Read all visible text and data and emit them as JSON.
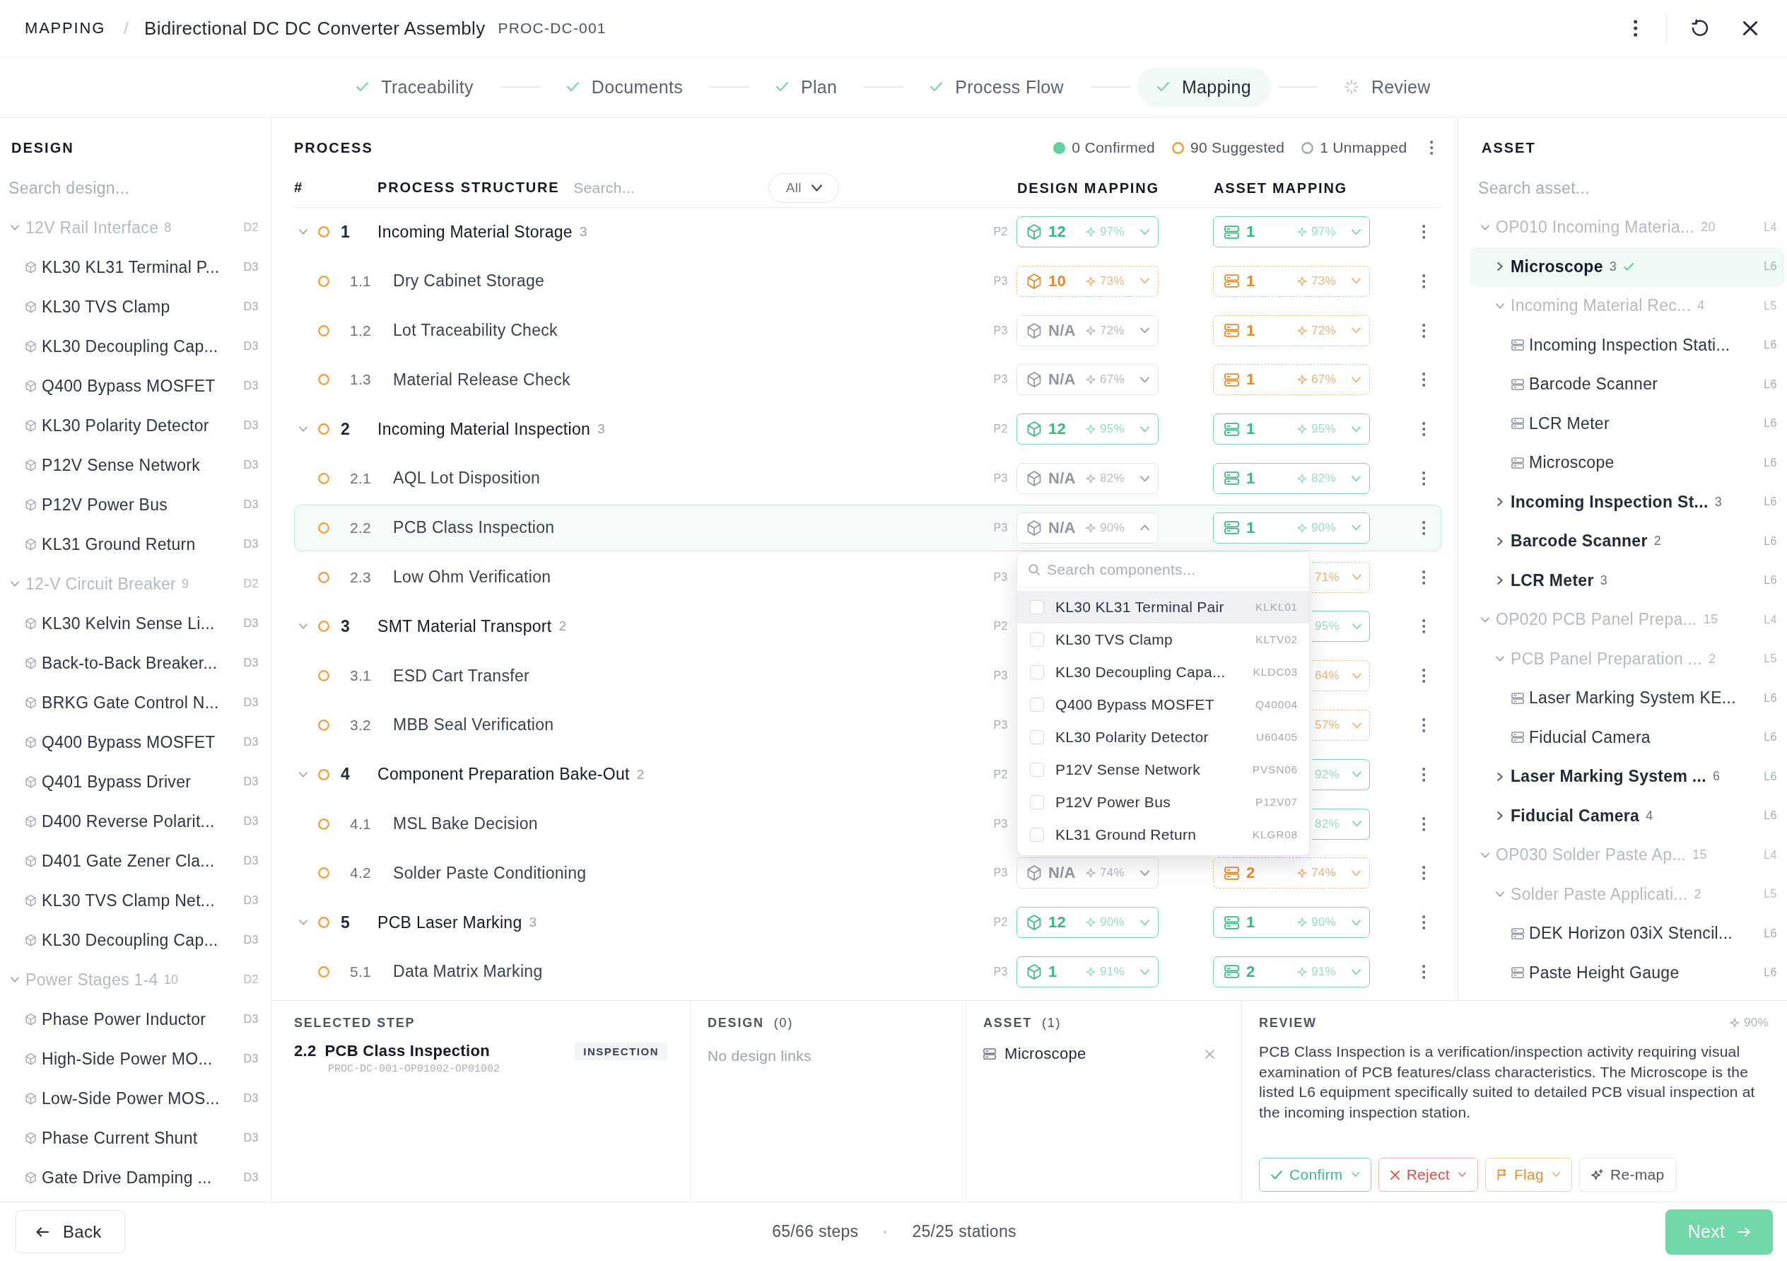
{
  "header": {
    "section": "MAPPING",
    "separator": "/",
    "title": "Bidirectional DC DC Converter Assembly",
    "code": "PROC-DC-001"
  },
  "steps": [
    {
      "label": "Traceability",
      "kind": "done",
      "selected": false
    },
    {
      "label": "Documents",
      "kind": "done",
      "selected": false
    },
    {
      "label": "Plan",
      "kind": "done",
      "selected": false
    },
    {
      "label": "Process Flow",
      "kind": "done",
      "selected": false
    },
    {
      "label": "Mapping",
      "kind": "done",
      "selected": true
    },
    {
      "label": "Review",
      "kind": "pending",
      "selected": false
    }
  ],
  "design_panel": {
    "title": "DESIGN",
    "search": {
      "placeholder": "Search design..."
    },
    "tree": [
      {
        "label": "12V Rail Interface",
        "count": "8",
        "tag": "D2",
        "expanded": true,
        "disabled": true,
        "children": [
          {
            "label": "KL30 KL31 Terminal P...",
            "tag": "D3"
          },
          {
            "label": "KL30 TVS Clamp",
            "tag": "D3"
          },
          {
            "label": "KL30 Decoupling Cap...",
            "tag": "D3"
          },
          {
            "label": "Q400 Bypass MOSFET",
            "tag": "D3"
          },
          {
            "label": "KL30 Polarity Detector",
            "tag": "D3"
          },
          {
            "label": "P12V Sense Network",
            "tag": "D3"
          },
          {
            "label": "P12V Power Bus",
            "tag": "D3"
          },
          {
            "label": "KL31 Ground Return",
            "tag": "D3"
          }
        ]
      },
      {
        "label": "12-V Circuit Breaker",
        "count": "9",
        "tag": "D2",
        "expanded": true,
        "disabled": true,
        "children": [
          {
            "label": "KL30 Kelvin Sense Li...",
            "tag": "D3"
          },
          {
            "label": "Back-to-Back Breaker...",
            "tag": "D3"
          },
          {
            "label": "BRKG Gate Control N...",
            "tag": "D3"
          },
          {
            "label": "Q400 Bypass MOSFET",
            "tag": "D3"
          },
          {
            "label": "Q401 Bypass Driver",
            "tag": "D3"
          },
          {
            "label": "D400 Reverse Polarit...",
            "tag": "D3"
          },
          {
            "label": "D401 Gate Zener Cla...",
            "tag": "D3"
          },
          {
            "label": "KL30 TVS Clamp Net...",
            "tag": "D3"
          },
          {
            "label": "KL30 Decoupling Cap...",
            "tag": "D3"
          }
        ]
      },
      {
        "label": "Power Stages 1-4",
        "count": "10",
        "tag": "D2",
        "expanded": true,
        "disabled": true,
        "children": [
          {
            "label": "Phase Power Inductor",
            "tag": "D3"
          },
          {
            "label": "High-Side Power MO...",
            "tag": "D3"
          },
          {
            "label": "Low-Side Power MOS...",
            "tag": "D3"
          },
          {
            "label": "Phase Current Shunt",
            "tag": "D3"
          },
          {
            "label": "Gate Drive Damping ...",
            "tag": "D3"
          }
        ]
      }
    ]
  },
  "process_panel": {
    "title": "PROCESS",
    "legend": [
      {
        "label": "0 Confirmed",
        "kind": "confirmed"
      },
      {
        "label": "90 Suggested",
        "kind": "suggested"
      },
      {
        "label": "1 Unmapped",
        "kind": "unmapped"
      }
    ],
    "columns": {
      "number": "#",
      "structure": "PROCESS STRUCTURE",
      "design": "DESIGN MAPPING",
      "asset": "ASSET MAPPING"
    },
    "search": {
      "placeholder": "Search..."
    },
    "filter": {
      "value": "All"
    },
    "rows": [
      {
        "number": "1",
        "name": "Incoming Material Storage",
        "count": "3",
        "tag": "P2",
        "kind": "suggested",
        "expanded": true,
        "selected": false,
        "design": {
          "kind": "high",
          "value": "12",
          "confidence": "97%",
          "open": false
        },
        "asset": {
          "kind": "high",
          "value": "1",
          "confidence": "97%"
        },
        "children": [
          {
            "number": "1.1",
            "name": "Dry Cabinet Storage",
            "tag": "P3",
            "kind": "suggested",
            "selected": false,
            "design": {
              "kind": "medium",
              "value": "10",
              "confidence": "73%",
              "open": false
            },
            "asset": {
              "kind": "medium",
              "value": "1",
              "confidence": "73%"
            }
          },
          {
            "number": "1.2",
            "name": "Lot Traceability Check",
            "tag": "P3",
            "kind": "suggested",
            "selected": false,
            "design": {
              "kind": "empty",
              "value": "N/A",
              "confidence": "72%",
              "open": false
            },
            "asset": {
              "kind": "medium",
              "value": "1",
              "confidence": "72%"
            }
          },
          {
            "number": "1.3",
            "name": "Material Release Check",
            "tag": "P3",
            "kind": "suggested",
            "selected": false,
            "design": {
              "kind": "empty",
              "value": "N/A",
              "confidence": "67%",
              "open": false
            },
            "asset": {
              "kind": "medium",
              "value": "1",
              "confidence": "67%"
            }
          }
        ]
      },
      {
        "number": "2",
        "name": "Incoming Material Inspection",
        "count": "3",
        "tag": "P2",
        "kind": "suggested",
        "expanded": true,
        "selected": false,
        "design": {
          "kind": "high",
          "value": "12",
          "confidence": "95%",
          "open": false
        },
        "asset": {
          "kind": "high",
          "value": "1",
          "confidence": "95%"
        },
        "children": [
          {
            "number": "2.1",
            "name": "AQL Lot Disposition",
            "tag": "P3",
            "kind": "suggested",
            "selected": false,
            "design": {
              "kind": "empty",
              "value": "N/A",
              "confidence": "82%",
              "open": false
            },
            "asset": {
              "kind": "high",
              "value": "1",
              "confidence": "82%"
            }
          },
          {
            "number": "2.2",
            "name": "PCB Class Inspection",
            "tag": "P3",
            "kind": "suggested",
            "selected": true,
            "design": {
              "kind": "empty",
              "value": "N/A",
              "confidence": "90%",
              "open": true
            },
            "asset": {
              "kind": "high",
              "value": "1",
              "confidence": "90%"
            }
          },
          {
            "number": "2.3",
            "name": "Low Ohm Verification",
            "tag": "P3",
            "kind": "suggested",
            "selected": false,
            "asset": {
              "kind": "medium",
              "confidence": "71%"
            }
          }
        ]
      },
      {
        "number": "3",
        "name": "SMT Material Transport",
        "count": "2",
        "tag": "P2",
        "kind": "suggested",
        "expanded": true,
        "selected": false,
        "asset": {
          "kind": "high",
          "confidence": "95%"
        },
        "children": [
          {
            "number": "3.1",
            "name": "ESD Cart Transfer",
            "tag": "P3",
            "kind": "suggested",
            "selected": false,
            "asset": {
              "kind": "medium",
              "confidence": "64%"
            }
          },
          {
            "number": "3.2",
            "name": "MBB Seal Verification",
            "tag": "P3",
            "kind": "suggested",
            "selected": false,
            "asset": {
              "kind": "medium",
              "confidence": "57%"
            }
          }
        ]
      },
      {
        "number": "4",
        "name": "Component Preparation Bake-Out",
        "count": "2",
        "tag": "P2",
        "kind": "suggested",
        "expanded": true,
        "selected": false,
        "asset": {
          "kind": "high",
          "confidence": "92%"
        },
        "children": [
          {
            "number": "4.1",
            "name": "MSL Bake Decision",
            "tag": "P3",
            "kind": "suggested",
            "selected": false,
            "asset": {
              "kind": "high",
              "confidence": "82%"
            }
          },
          {
            "number": "4.2",
            "name": "Solder Paste Conditioning",
            "tag": "P3",
            "kind": "suggested",
            "selected": false,
            "design": {
              "kind": "empty",
              "value": "N/A",
              "confidence": "74%",
              "open": false
            },
            "asset": {
              "kind": "medium",
              "value": "2",
              "confidence": "74%"
            }
          }
        ]
      },
      {
        "number": "5",
        "name": "PCB Laser Marking",
        "count": "3",
        "tag": "P2",
        "kind": "suggested",
        "expanded": true,
        "selected": false,
        "design": {
          "kind": "high",
          "value": "12",
          "confidence": "90%",
          "open": false
        },
        "asset": {
          "kind": "high",
          "value": "1",
          "confidence": "90%"
        },
        "children": [
          {
            "number": "5.1",
            "name": "Data Matrix Marking",
            "tag": "P3",
            "kind": "suggested",
            "selected": false,
            "design": {
              "kind": "high",
              "value": "1",
              "confidence": "91%",
              "open": false
            },
            "asset": {
              "kind": "high",
              "value": "2",
              "confidence": "91%"
            }
          }
        ]
      }
    ],
    "component_picker": {
      "search": {
        "placeholder": "Search components..."
      },
      "items": [
        {
          "label": "KL30 KL31 Terminal Pair",
          "code": "KLKL01",
          "checked": false,
          "highlighted": true
        },
        {
          "label": "KL30 TVS Clamp",
          "code": "KLTV02",
          "checked": false,
          "highlighted": false
        },
        {
          "label": "KL30 Decoupling Capa...",
          "code": "KLDC03",
          "checked": false,
          "highlighted": false
        },
        {
          "label": "Q400 Bypass MOSFET",
          "code": "Q40004",
          "checked": false,
          "highlighted": false
        },
        {
          "label": "KL30 Polarity Detector",
          "code": "U60405",
          "checked": false,
          "highlighted": false
        },
        {
          "label": "P12V Sense Network",
          "code": "PVSN06",
          "checked": false,
          "highlighted": false
        },
        {
          "label": "P12V Power Bus",
          "code": "P12V07",
          "checked": false,
          "highlighted": false
        },
        {
          "label": "KL31 Ground Return",
          "code": "KLGR08",
          "checked": false,
          "highlighted": false
        }
      ]
    }
  },
  "asset_panel": {
    "title": "ASSET",
    "search": {
      "placeholder": "Search asset..."
    },
    "tree": [
      {
        "label": "OP010 Incoming Materia...",
        "count": "20",
        "tag": "L4",
        "expanded": true,
        "disabled": true,
        "selected": false,
        "mapped": false,
        "children": [
          {
            "label": "Microscope",
            "count": "3",
            "tag": "L6",
            "expanded": false,
            "disabled": false,
            "selected": true,
            "mapped": true
          },
          {
            "label": "Incoming Material Rec...",
            "count": "4",
            "tag": "L5",
            "expanded": true,
            "disabled": true,
            "selected": false,
            "mapped": false,
            "children": [
              {
                "label": "Incoming Inspection Stati...",
                "tag": "L6",
                "selected": false
              },
              {
                "label": "Barcode Scanner",
                "tag": "L6",
                "selected": false
              },
              {
                "label": "LCR Meter",
                "tag": "L6",
                "selected": false
              },
              {
                "label": "Microscope",
                "tag": "L6",
                "selected": false
              }
            ]
          },
          {
            "label": "Incoming Inspection St...",
            "count": "3",
            "tag": "L6",
            "expanded": false,
            "disabled": false,
            "selected": false,
            "mapped": false
          },
          {
            "label": "Barcode Scanner",
            "count": "2",
            "tag": "L6",
            "expanded": false,
            "disabled": false,
            "selected": false,
            "mapped": false
          },
          {
            "label": "LCR Meter",
            "count": "3",
            "tag": "L6",
            "expanded": false,
            "disabled": false,
            "selected": false,
            "mapped": false
          }
        ]
      },
      {
        "label": "OP020 PCB Panel Prepa...",
        "count": "15",
        "tag": "L4",
        "expanded": true,
        "disabled": true,
        "selected": false,
        "mapped": false,
        "children": [
          {
            "label": "PCB Panel Preparation ...",
            "count": "2",
            "tag": "L5",
            "expanded": true,
            "disabled": true,
            "selected": false,
            "mapped": false,
            "children": [
              {
                "label": "Laser Marking System KE...",
                "tag": "L6",
                "selected": false
              },
              {
                "label": "Fiducial Camera",
                "tag": "L6",
                "selected": false
              }
            ]
          },
          {
            "label": "Laser Marking System ...",
            "count": "6",
            "tag": "L6",
            "expanded": false,
            "disabled": false,
            "selected": false,
            "mapped": false
          },
          {
            "label": "Fiducial Camera",
            "count": "4",
            "tag": "L6",
            "expanded": false,
            "disabled": false,
            "selected": false,
            "mapped": false
          }
        ]
      },
      {
        "label": "OP030 Solder Paste Ap...",
        "count": "15",
        "tag": "L4",
        "expanded": true,
        "disabled": true,
        "selected": false,
        "mapped": false,
        "children": [
          {
            "label": "Solder Paste Applicati...",
            "count": "2",
            "tag": "L5",
            "expanded": true,
            "disabled": true,
            "selected": false,
            "mapped": false,
            "children": [
              {
                "label": "DEK Horizon 03iX Stencil...",
                "tag": "L6",
                "selected": false
              },
              {
                "label": "Paste Height Gauge",
                "tag": "L6",
                "selected": false
              }
            ]
          }
        ]
      }
    ]
  },
  "details": {
    "selected_step": {
      "title": "SELECTED STEP",
      "number": "2.2",
      "name": "PCB Class Inspection",
      "type": "INSPECTION",
      "path": "PROC-DC-001-OP01002-OP01002"
    },
    "design": {
      "title": "DESIGN",
      "count": "(0)",
      "empty_text": "No design links"
    },
    "asset": {
      "title": "ASSET",
      "count": "(1)",
      "items": [
        {
          "label": "Microscope"
        }
      ]
    },
    "review": {
      "title": "REVIEW",
      "confidence": "90%",
      "text": "PCB Class Inspection is a verification/inspection activity requiring visual examination of PCB features/class characteristics. The Microscope is the listed L6 equipment specifically suited to detailed PCB visual inspection at the incoming inspection station.",
      "actions": [
        {
          "label": "Confirm",
          "kind": "confirm",
          "menu": true
        },
        {
          "label": "Reject",
          "kind": "reject",
          "menu": true
        },
        {
          "label": "Flag",
          "kind": "flag",
          "menu": true
        },
        {
          "label": "Re-map",
          "kind": "remap",
          "menu": false
        }
      ]
    }
  },
  "footer": {
    "back": "Back",
    "steps": "65/66 steps",
    "stations": "25/25 stations",
    "next": "Next"
  }
}
